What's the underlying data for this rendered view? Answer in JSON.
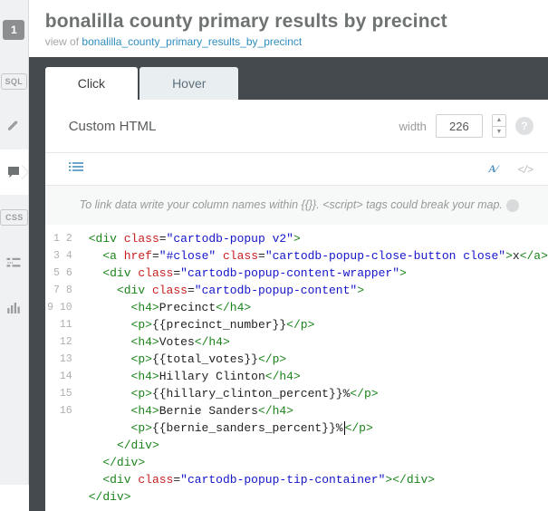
{
  "sidebar": {
    "layer_number": "1",
    "sql_label": "SQL",
    "css_label": "CSS"
  },
  "header": {
    "title": "bonalilla county primary results by precinct",
    "view_prefix": "view of",
    "view_link": "bonalilla_county_primary_results_by_precinct"
  },
  "tabs": {
    "click": "Click",
    "hover": "Hover"
  },
  "options": {
    "custom_html": "Custom HTML",
    "width_label": "width",
    "width_value": "226",
    "help": "?"
  },
  "toolbar": {
    "ay": "A⁄",
    "slashtags": "</>"
  },
  "hint": "To link data write your column names within {{}}. <script> tags could break your map.",
  "code": {
    "line_numbers": [
      "1",
      "2",
      "3",
      "4",
      "5",
      "6",
      "7",
      "8",
      "9",
      "10",
      "11",
      "12",
      "13",
      "14",
      "15",
      "16"
    ],
    "l1": {
      "open": "<div",
      "a": " class",
      "eq": "=",
      "v": "\"cartodb-popup v2\"",
      "close": ">"
    },
    "l2": {
      "open": "<a",
      "a1": " href",
      "v1": "\"#close\"",
      "a2": " class",
      "v2": "\"cartodb-popup-close-button close\"",
      "close": ">",
      "txt": "x",
      "end": "</a>"
    },
    "l3": {
      "open": "<div",
      "a": " class",
      "v": "\"cartodb-popup-content-wrapper\"",
      "close": ">"
    },
    "l4": {
      "open": "<div",
      "a": " class",
      "v": "\"cartodb-popup-content\"",
      "close": ">"
    },
    "l5": {
      "open": "<h4>",
      "txt": "Precinct",
      "end": "</h4>"
    },
    "l6": {
      "open": "<p>",
      "txt": "{{precinct_number}}",
      "end": "</p>"
    },
    "l7": {
      "open": "<h4>",
      "txt": "Votes",
      "end": "</h4>"
    },
    "l8": {
      "open": "<p>",
      "txt": "{{total_votes}}",
      "end": "</p>"
    },
    "l9": {
      "open": "<h4>",
      "txt": "Hillary Clinton",
      "end": "</h4>"
    },
    "l10": {
      "open": "<p>",
      "txt": "{{hillary_clinton_percent}}%",
      "end": "</p>"
    },
    "l11": {
      "open": "<h4>",
      "txt": "Bernie Sanders",
      "end": "</h4>"
    },
    "l12": {
      "open": "<p>",
      "txt": "{{bernie_sanders_percent}}%",
      "end": "</p>"
    },
    "l13": {
      "end": "</div>"
    },
    "l14": {
      "end": "</div>"
    },
    "l15": {
      "open": "<div",
      "a": " class",
      "v": "\"cartodb-popup-tip-container\"",
      "close": ">",
      "end": "</div>"
    },
    "l16": {
      "end": "</div>"
    }
  }
}
